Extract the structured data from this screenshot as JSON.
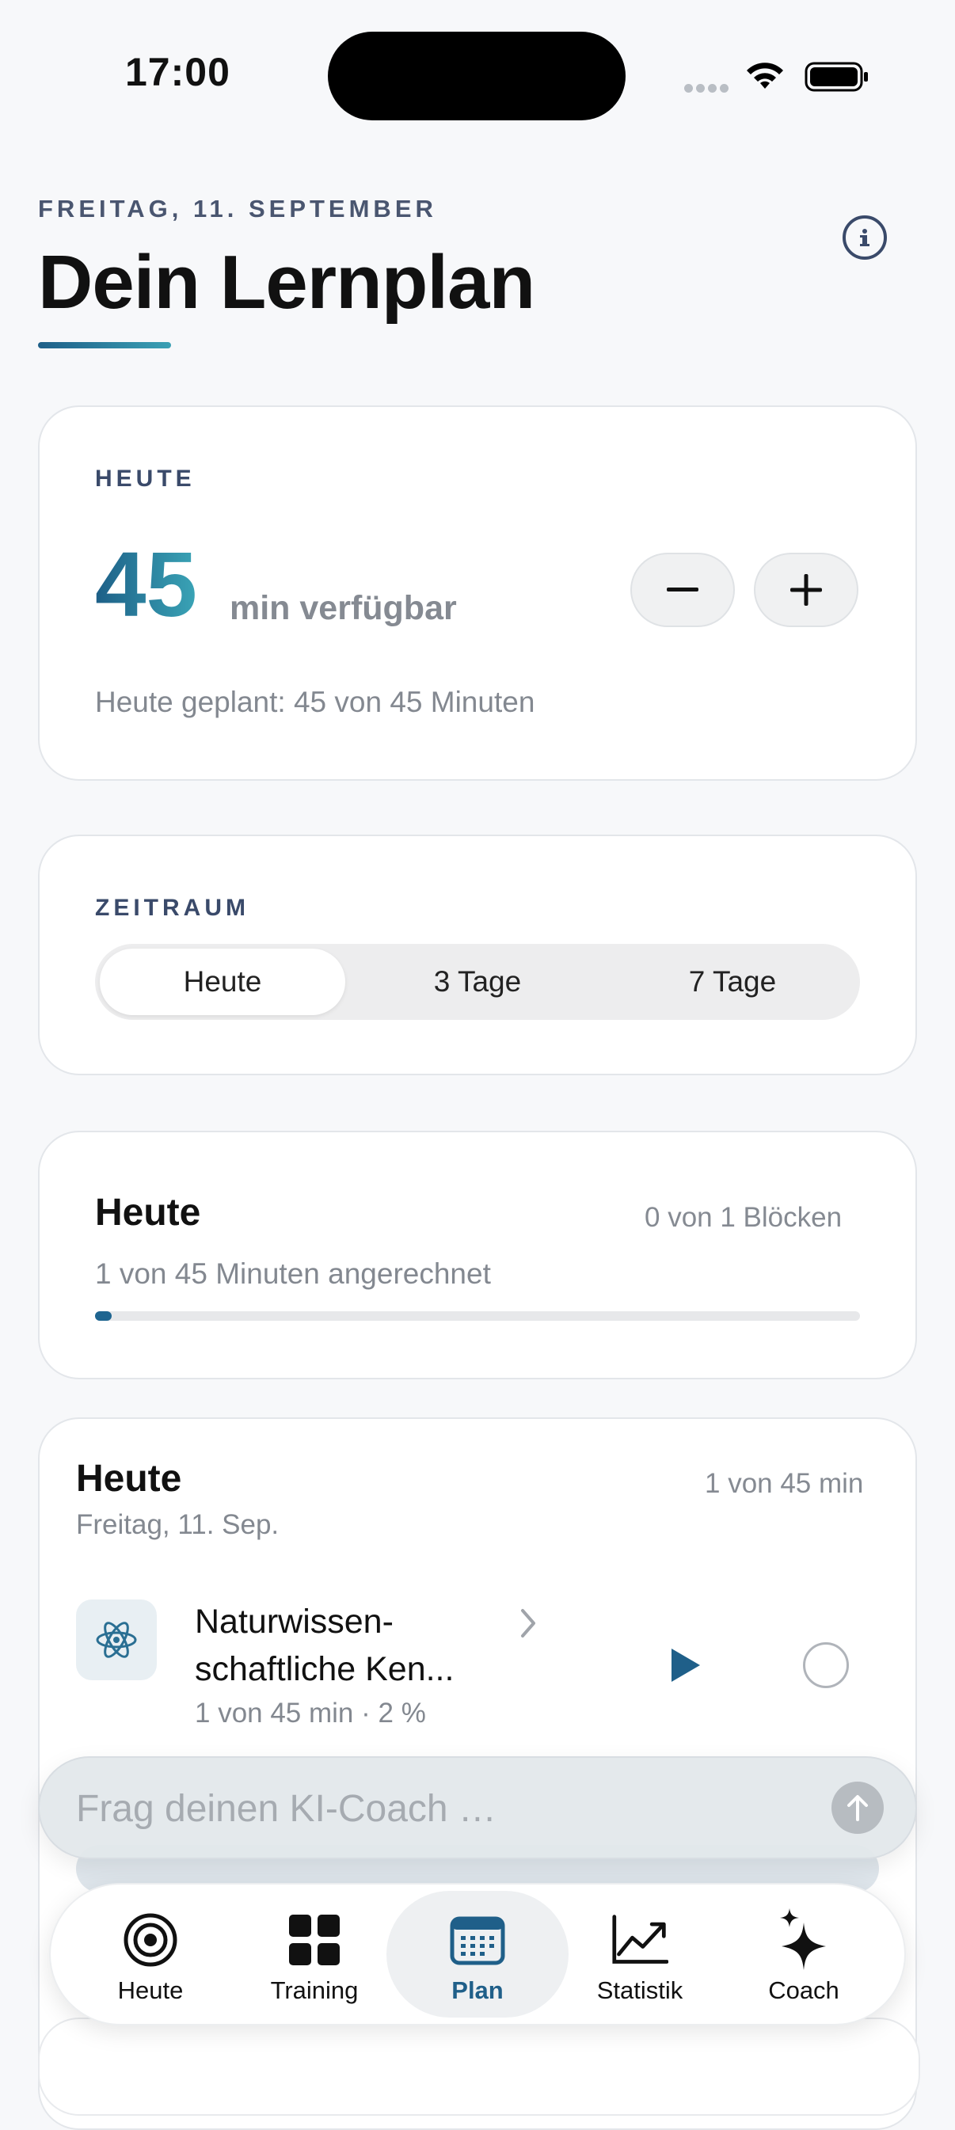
{
  "status_bar": {
    "time": "17:00"
  },
  "header": {
    "date": "FREITAG, 11. SEPTEMBER",
    "title": "Dein Lernplan"
  },
  "today_card": {
    "label": "HEUTE",
    "minutes": "45",
    "minutes_suffix": "min verfügbar",
    "decrease_label": "−",
    "increase_label": "+",
    "planned_text": "Heute geplant: 45 von 45 Minuten"
  },
  "range_card": {
    "label": "ZEITRAUM",
    "options": [
      "Heute",
      "3 Tage",
      "7 Tage"
    ],
    "selected": "Heute"
  },
  "progress_card": {
    "title": "Heute",
    "blocks_text": "0 von 1 Blöcken",
    "minutes_text": "1 von 45 Minuten angerechnet",
    "progress_fraction": 0.022
  },
  "day_card": {
    "title": "Heute",
    "date": "Freitag, 11. Sep.",
    "minutes": "1 von 45 min",
    "subject": {
      "title": "Naturwissen-schaftliche Ken...",
      "meta": "1 von 45 min · 2 %",
      "icon": "atom-icon"
    }
  },
  "coach": {
    "placeholder": "Frag deinen KI-Coach …"
  },
  "tabs": [
    {
      "label": "Heute",
      "icon": "target-icon"
    },
    {
      "label": "Training",
      "icon": "grid-icon"
    },
    {
      "label": "Plan",
      "icon": "calendar-icon"
    },
    {
      "label": "Statistik",
      "icon": "chart-line-icon"
    },
    {
      "label": "Coach",
      "icon": "sparkles-icon"
    }
  ],
  "colors": {
    "accent": "#1f5f89",
    "accent_light": "#3aa4b6",
    "background": "#f7f8fa"
  }
}
